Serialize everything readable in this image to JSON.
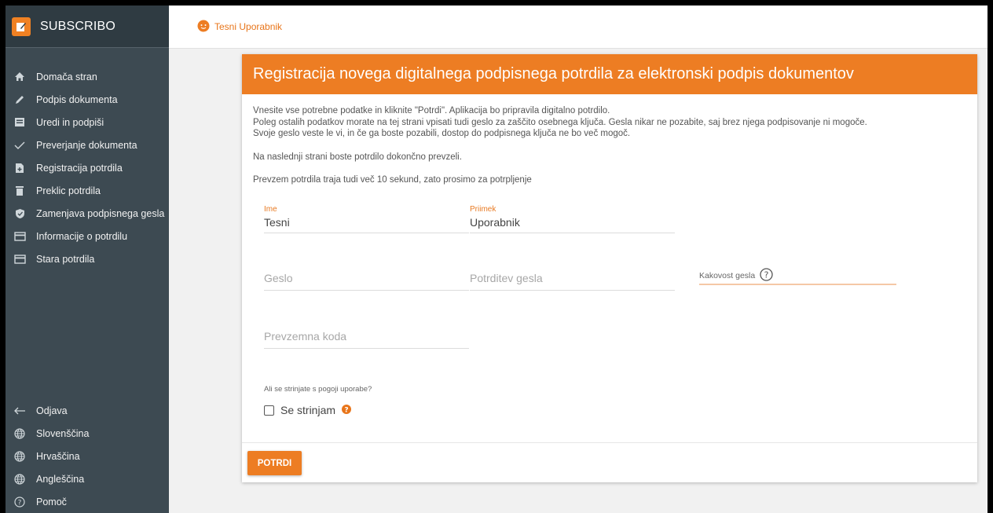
{
  "brand": {
    "name": "SUBSCRIBO"
  },
  "sidebar": {
    "items": [
      {
        "label": "Domača stran",
        "icon": "home-icon"
      },
      {
        "label": "Podpis dokumenta",
        "icon": "pen-icon"
      },
      {
        "label": "Uredi in podpiši",
        "icon": "edit-document-icon"
      },
      {
        "label": "Preverjanje dokumenta",
        "icon": "checkmark-icon"
      },
      {
        "label": "Registracija potrdila",
        "icon": "file-plus-icon"
      },
      {
        "label": "Preklic potrdila",
        "icon": "trash-icon"
      },
      {
        "label": "Zamenjava podpisnega gesla",
        "icon": "shield-check-icon"
      },
      {
        "label": "Informacije o potrdilu",
        "icon": "card-icon"
      },
      {
        "label": "Stara potrdila",
        "icon": "card-icon"
      }
    ],
    "bottom": [
      {
        "label": "Odjava",
        "icon": "arrow-left-icon"
      },
      {
        "label": "Slovenščina",
        "icon": "globe-icon"
      },
      {
        "label": "Hrvaščina",
        "icon": "globe-icon"
      },
      {
        "label": "Angleščina",
        "icon": "globe-icon"
      },
      {
        "label": "Pomoč",
        "icon": "help-circle-icon"
      }
    ]
  },
  "header": {
    "user": "Tesni Uporabnik"
  },
  "card": {
    "title": "Registracija novega digitalnega podpisnega potrdila za elektronski podpis dokumentov",
    "intro": [
      "Vnesite vse potrebne podatke in kliknite \"Potrdi\". Aplikacija bo pripravila digitalno potrdilo.",
      "Poleg ostalih podatkov morate na tej strani vpisati tudi geslo za zaščito osebnega ključa. Gesla nikar ne pozabite, saj brez njega podpisovanje ni mogoče.",
      "Svoje geslo veste le vi, in če ga boste pozabili, dostop do podpisnega ključa ne bo več mogoč."
    ],
    "note1": "Na naslednji strani boste potrdilo dokončno prevzeli.",
    "note2": "Prevzem potrdila traja tudi več 10 sekund, zato prosimo za potrpljenje",
    "fields": {
      "ime": {
        "label": "Ime",
        "value": "Tesni"
      },
      "priimek": {
        "label": "Priimek",
        "value": "Uporabnik"
      },
      "geslo": {
        "placeholder": "Geslo"
      },
      "potrditev": {
        "placeholder": "Potrditev gesla"
      },
      "kakovost": {
        "label": "Kakovost gesla"
      },
      "koda": {
        "placeholder": "Prevzemna koda"
      }
    },
    "agree_question": "Ali se strinjate s pogoji uporabe?",
    "agree_label": "Se strinjam",
    "submit": "POTRDI"
  },
  "colors": {
    "accent": "#ed7d23",
    "sidebar": "#3d4a52"
  }
}
